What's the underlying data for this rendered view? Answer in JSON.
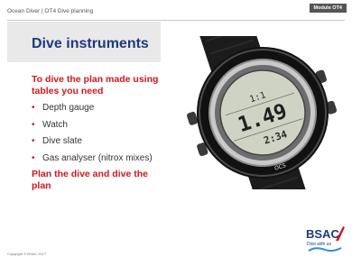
{
  "header": {
    "text": "Ocean Diver  |  OT4 Dive planning",
    "module_badge": "Module OT4"
  },
  "slide": {
    "title": "Dive instruments",
    "lead": "To dive the plan made using tables you need",
    "bullets": [
      "Depth gauge",
      "Watch",
      "Dive slate",
      "Gas analyser (nitrox mixes)"
    ],
    "closing": "Plan the dive and dive the plan"
  },
  "watch": {
    "display_depth": "1.49",
    "display_time": "2:34",
    "display_small": "1:1",
    "brand": "OCS"
  },
  "footer": {
    "copyright": "Copyright © BSAC 2017",
    "logo_text": "BSAC",
    "logo_tagline": "Dive with us"
  },
  "colors": {
    "title_blue": "#1f3a7a",
    "accent_red": "#d0171f",
    "badge_grey": "#555555",
    "panel_grey": "#e9e9e9"
  }
}
